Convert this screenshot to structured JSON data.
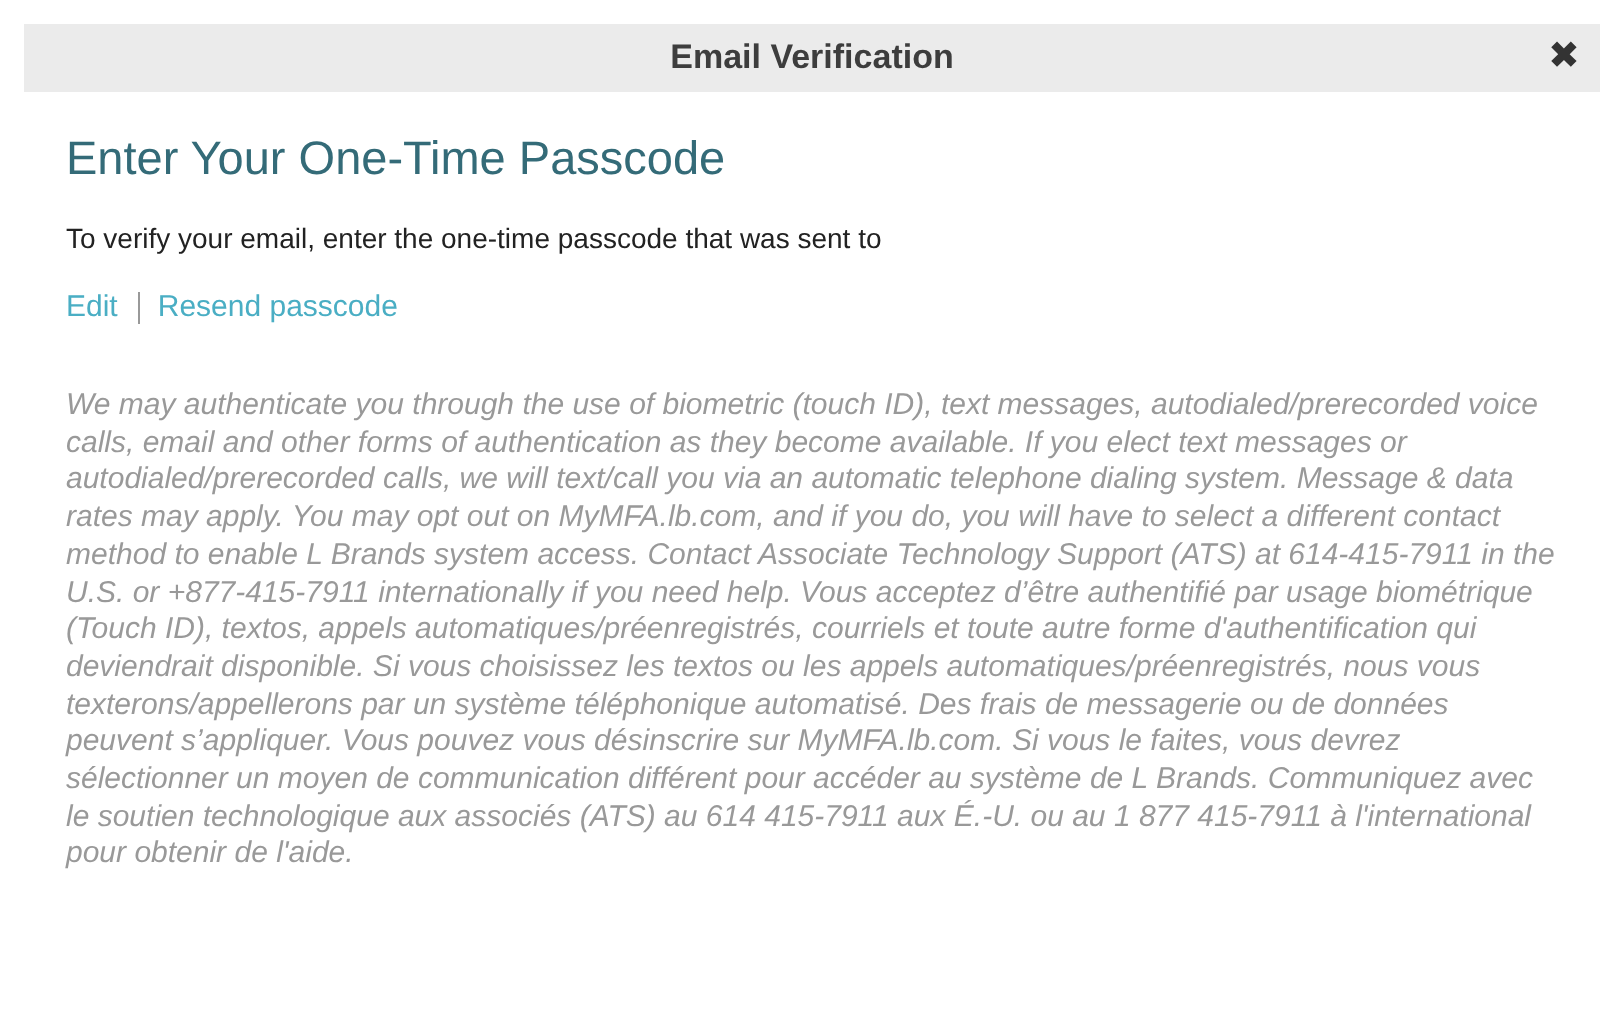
{
  "window": {
    "title": "Email Verification",
    "close": "✖"
  },
  "heading": "Enter Your One-Time Passcode",
  "instruction": "To verify your email, enter the one-time passcode that was sent to",
  "links": [
    "Edit",
    "Resend passcode"
  ],
  "disclaimer": "We may authenticate you through the use of biometric (touch ID), text messages, autodialed/prerecorded voice calls, email and other forms of authentication as they become available. If you elect text messages or autodialed/prerecorded calls, we will text/call you via an automatic telephone dialing system. Message & data rates may apply. You may opt out on MyMFA.lb.com, and if you do, you will have to select a different contact method to enable L Brands system access. Contact Associate Technology Support (ATS) at 614-415-7911 in the U.S. or +877-415-7911 internationally if you need help. Vous acceptez d’être authentifié par usage biométrique (Touch ID), textos, appels automatiques/préenregistrés, courriels et toute autre forme d'authentification qui deviendrait disponible. Si vous choisissez les textos ou les appels automatiques/préenregistrés, nous vous texterons/appellerons par un système téléphonique automatisé. Des frais de messagerie ou de données peuvent s’appliquer. Vous pouvez vous désinscrire sur MyMFA.lb.com. Si vous le faites, vous devrez sélectionner un moyen de communication différent pour accéder au système de L Brands. Communiquez avec le soutien technologique aux associés (ATS) au 614 415-7911 aux É.-U. ou au 1 877 415-7911 à l'international pour obtenir de l'aide."
}
